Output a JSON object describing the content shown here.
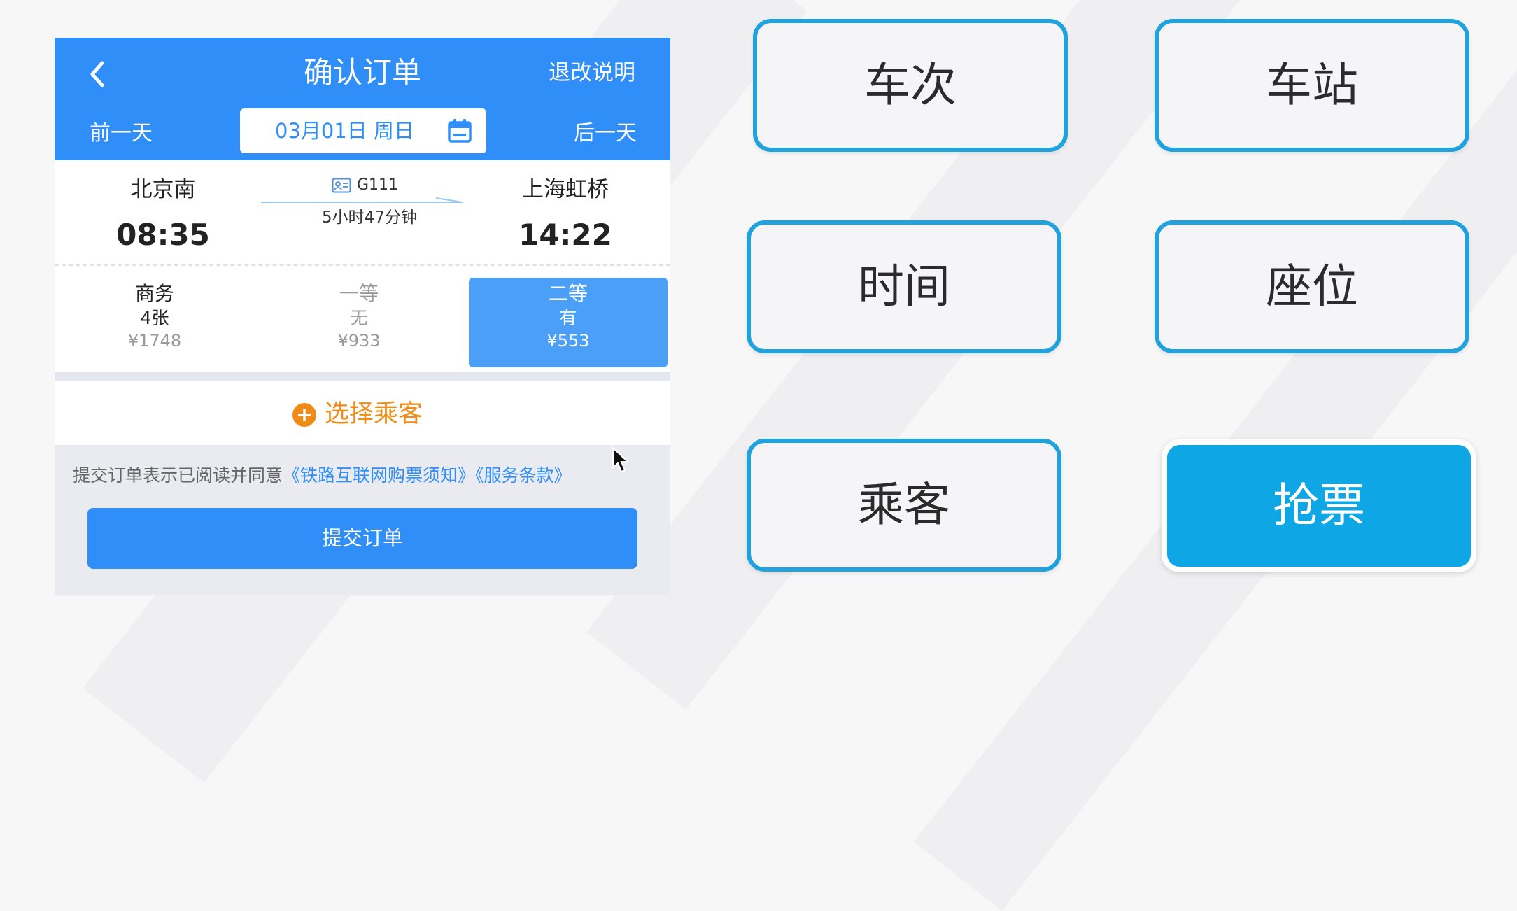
{
  "header": {
    "title": "确认订单",
    "refund_link": "退改说明",
    "prev_day": "前一天",
    "next_day": "后一天",
    "date": "03月01日 周日"
  },
  "trip": {
    "from_station": "北京南",
    "to_station": "上海虹桥",
    "depart_time": "08:35",
    "arrive_time": "14:22",
    "train_no": "G111",
    "duration": "5小时47分钟"
  },
  "seats": [
    {
      "name": "商务",
      "count": "4张",
      "price": "¥1748"
    },
    {
      "name": "一等",
      "count": "无",
      "price": "¥933"
    },
    {
      "name": "二等",
      "count": "有",
      "price": "¥553"
    }
  ],
  "passenger": {
    "select_label": "选择乘客"
  },
  "agreement": {
    "prefix": "提交订单表示已阅读并同意",
    "link1": "《铁路互联网购票须知》",
    "link2": "《服务条款》"
  },
  "submit": {
    "label": "提交订单"
  },
  "keywords": {
    "train": "车次",
    "station": "车站",
    "time": "时间",
    "seat": "座位",
    "passenger": "乘客",
    "grab": "抢票"
  },
  "colors": {
    "primary": "#2f8ef8",
    "accent_orange": "#f08b16",
    "card_border": "#1fa2dd",
    "grab_button": "#0ea6e4"
  },
  "icons": {
    "back": "chevron-left-icon",
    "calendar": "calendar-icon",
    "ticket": "ticket-icon",
    "add": "plus-circle-icon",
    "cursor": "mouse-cursor-icon"
  }
}
